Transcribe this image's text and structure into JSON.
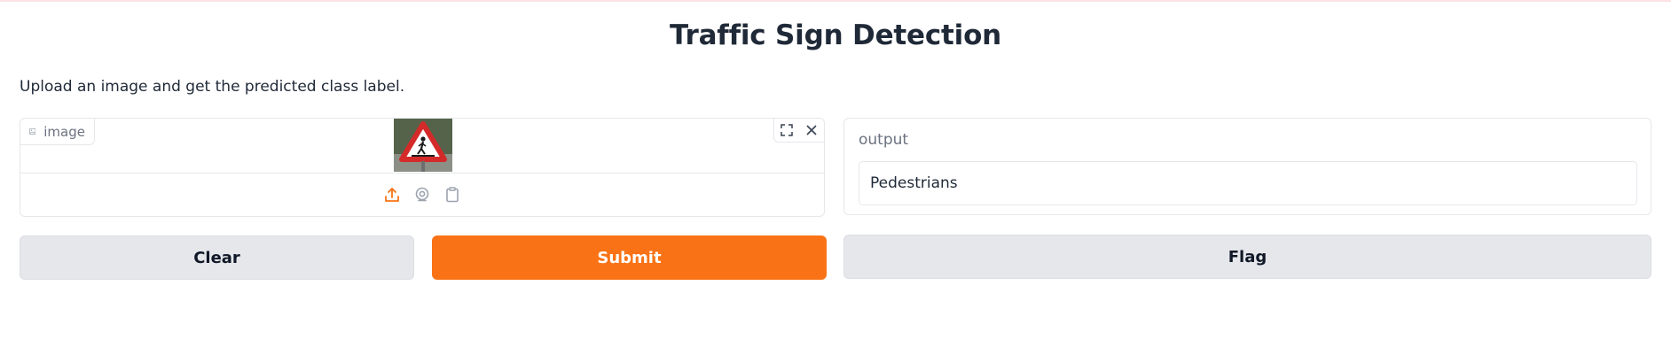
{
  "app": {
    "title": "Traffic Sign Detection",
    "description": "Upload an image and get the predicted class label."
  },
  "input": {
    "label": "image",
    "icons": {
      "label_icon": "image-icon",
      "fullscreen": "fullscreen-icon",
      "clear": "close-icon",
      "upload": "upload-icon",
      "webcam": "webcam-icon",
      "clipboard": "clipboard-icon"
    },
    "preview": "pedestrian-crossing-warning-sign"
  },
  "output": {
    "label": "output",
    "value": "Pedestrians"
  },
  "buttons": {
    "clear": "Clear",
    "submit": "Submit",
    "flag": "Flag"
  },
  "colors": {
    "accent": "#f97316",
    "secondary_button": "#e5e7eb",
    "border": "#e5e7eb",
    "muted_text": "#6b7280"
  }
}
